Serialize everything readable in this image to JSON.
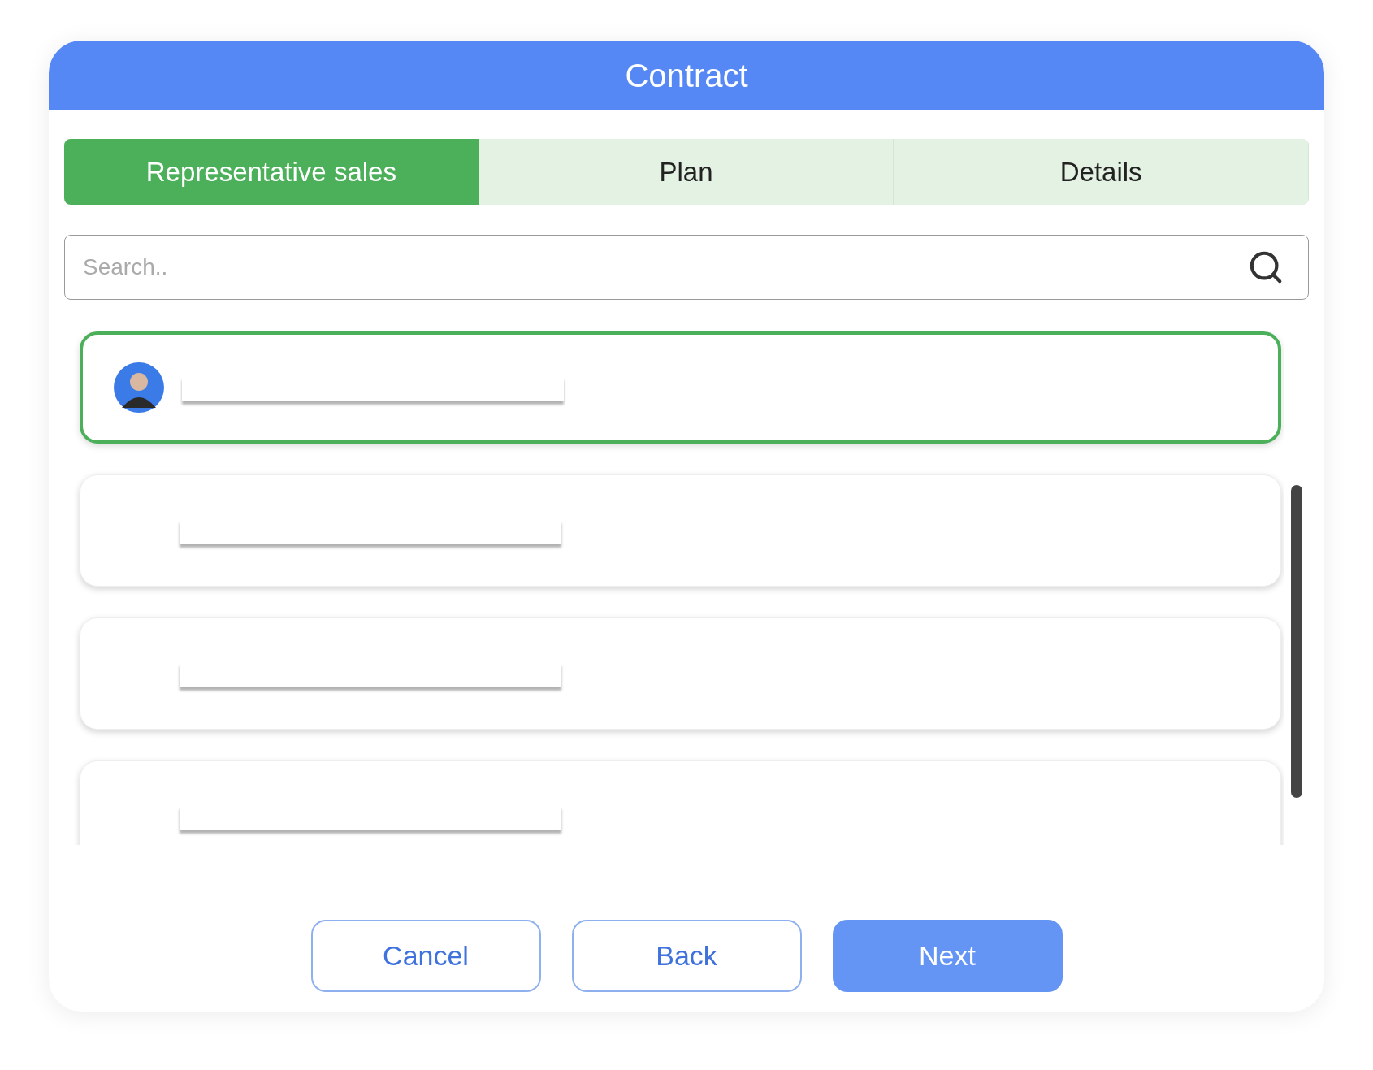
{
  "dialog": {
    "title": "Contract"
  },
  "tabs": [
    {
      "label": "Representative sales",
      "selected": true
    },
    {
      "label": "Plan",
      "selected": false
    },
    {
      "label": "Details",
      "selected": false
    }
  ],
  "search": {
    "placeholder": "Search.."
  },
  "people": [
    {
      "selected": true,
      "avatar": true
    },
    {
      "selected": false,
      "avatar": false
    },
    {
      "selected": false,
      "avatar": false
    },
    {
      "selected": false,
      "avatar": false
    }
  ],
  "buttons": [
    {
      "label": "Cancel",
      "kind": "outline"
    },
    {
      "label": "Back",
      "kind": "outline"
    },
    {
      "label": "Next",
      "kind": "primary"
    }
  ]
}
